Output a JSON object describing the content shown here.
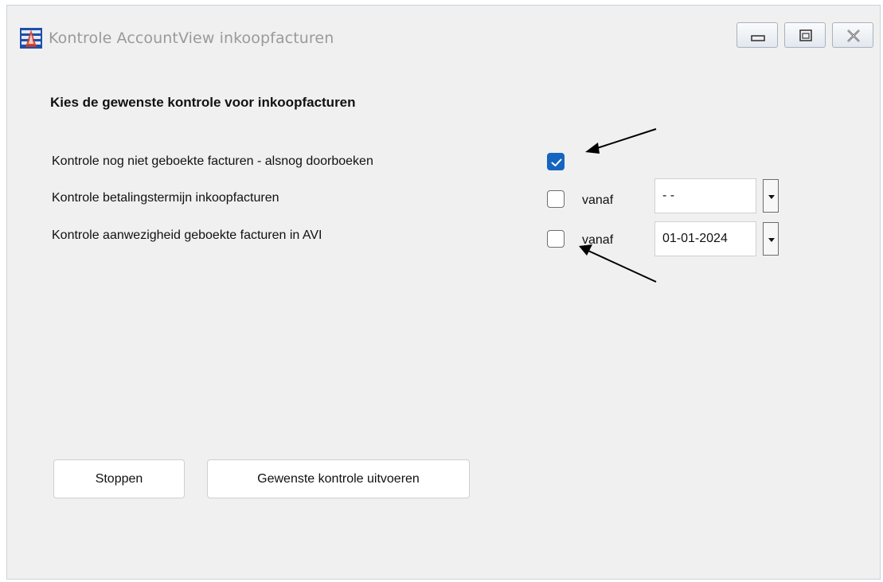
{
  "window": {
    "title": "Kontrole AccountView inkoopfacturen",
    "app_icon": "accountview-app-icon",
    "controls": [
      "minimize-icon",
      "maximize-icon",
      "close-icon"
    ]
  },
  "heading": "Kies de gewenste kontrole voor inkoopfacturen",
  "options": [
    {
      "label": "Kontrole nog niet geboekte facturen - alsnog doorboeken",
      "checked": true
    },
    {
      "label": "Kontrole betalingstermijn inkoopfacturen",
      "checked": false,
      "from_label": "vanaf",
      "date_value": "- -"
    },
    {
      "label": "Kontrole aanwezigheid geboekte facturen in AVI",
      "checked": false,
      "from_label": "vanaf",
      "date_value": "01-01-2024"
    }
  ],
  "buttons": {
    "stop": "Stoppen",
    "run": "Gewenste kontrole uitvoeren"
  },
  "colors": {
    "checkbox_checked": "#1565c0",
    "window_bg": "#f0f0f0"
  }
}
